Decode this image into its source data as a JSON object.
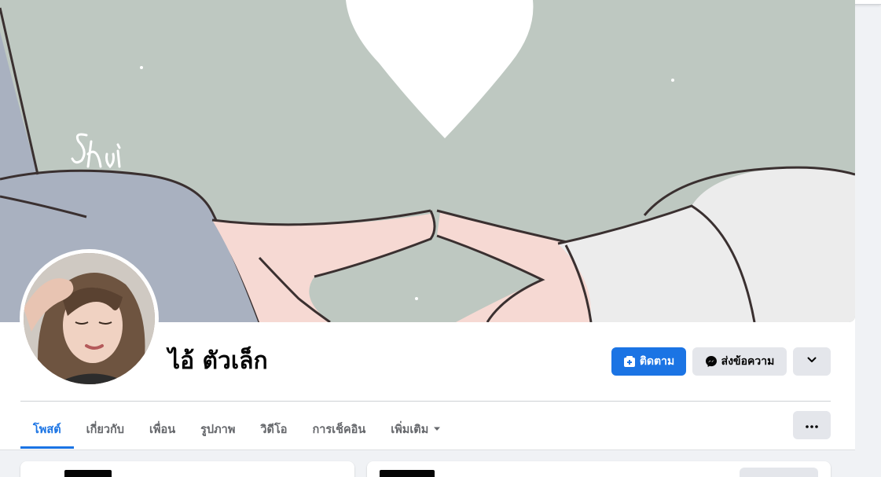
{
  "profile": {
    "name": "ไอ้ ตัวเล็ก"
  },
  "actions": {
    "follow_label": "ติดตาม",
    "message_label": "ส่งข้อความ"
  },
  "tabs": [
    {
      "label": "โพสต์",
      "active": true
    },
    {
      "label": "เกี่ยวกับ",
      "active": false
    },
    {
      "label": "เพื่อน",
      "active": false
    },
    {
      "label": "รูปภาพ",
      "active": false
    },
    {
      "label": "วิดีโอ",
      "active": false
    },
    {
      "label": "การเช็คอิน",
      "active": false
    },
    {
      "label": "เพิ่มเติม",
      "active": false
    }
  ],
  "colors": {
    "accent": "#1b74e4",
    "secondary_button": "#e4e6eb",
    "cover_background": "#bec8c1",
    "cover_hand_pink": "#f6d9d3",
    "cover_sleeve_blue": "#a9b1c0",
    "cover_sleeve_white": "#ececec"
  },
  "icons": {
    "follow": "follow-icon",
    "message": "messenger-icon",
    "more": "chevron-down-icon",
    "options": "more-dots-icon",
    "tab_more": "caret-down-icon"
  }
}
